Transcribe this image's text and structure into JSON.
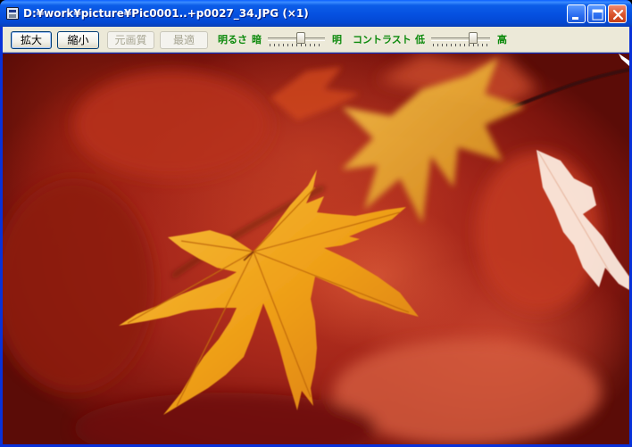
{
  "window": {
    "title": "D:¥work¥picture¥Pic0001..+p0027_34.JPG (×1)",
    "colors": {
      "titlebar": "#0550e0",
      "toolbar": "#ece9d8",
      "label_green": "#0d8a0d"
    }
  },
  "toolbar": {
    "zoom_in_label": "拡大",
    "zoom_out_label": "縮小",
    "original_quality_label": "元画質",
    "optimize_label": "最適",
    "brightness": {
      "label": "明るさ",
      "low_label": "暗",
      "high_label": "明",
      "value": 0.6
    },
    "contrast": {
      "label": "コントラスト",
      "low_label": "低",
      "high_label": "高",
      "value": 0.75
    }
  },
  "image": {
    "description_icon": "photo-maple-leaves",
    "colors": {
      "background": "#a4261a",
      "leaf": "#f0a21a"
    }
  }
}
